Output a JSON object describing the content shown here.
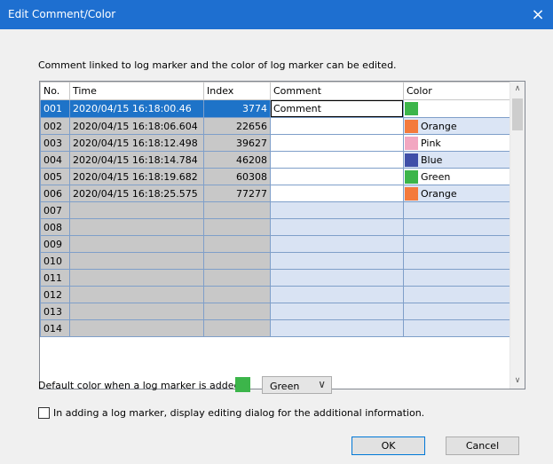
{
  "window": {
    "title": "Edit Comment/Color"
  },
  "instruction": "Comment linked to log marker and the color of log marker can be edited.",
  "grid": {
    "columns": [
      "No.",
      "Time",
      "Index",
      "Comment",
      "Color"
    ],
    "rows": [
      {
        "no": "001",
        "time": "2020/04/15 16:18:00.46",
        "index": "3774",
        "comment": "Comment",
        "color": "Green",
        "swatch": "#3cb54a"
      },
      {
        "no": "002",
        "time": "2020/04/15 16:18:06.604",
        "index": "22656",
        "comment": "",
        "color": "Orange",
        "swatch": "#f47a3c"
      },
      {
        "no": "003",
        "time": "2020/04/15 16:18:12.498",
        "index": "39627",
        "comment": "",
        "color": "Pink",
        "swatch": "#f2a7c1"
      },
      {
        "no": "004",
        "time": "2020/04/15 16:18:14.784",
        "index": "46208",
        "comment": "",
        "color": "Blue",
        "swatch": "#3f4fa8"
      },
      {
        "no": "005",
        "time": "2020/04/15 16:18:19.682",
        "index": "60308",
        "comment": "",
        "color": "Green",
        "swatch": "#3cb54a"
      },
      {
        "no": "006",
        "time": "2020/04/15 16:18:25.575",
        "index": "77277",
        "comment": "",
        "color": "Orange",
        "swatch": "#f47a3c"
      },
      {
        "no": "007"
      },
      {
        "no": "008"
      },
      {
        "no": "009"
      },
      {
        "no": "010"
      },
      {
        "no": "011"
      },
      {
        "no": "012"
      },
      {
        "no": "013"
      },
      {
        "no": "014"
      }
    ]
  },
  "default_color": {
    "label": "Default color when a log marker is added:",
    "value": "Green",
    "swatch": "#3cb54a"
  },
  "checkbox": {
    "label": "In adding a log marker, display editing dialog for the additional information."
  },
  "buttons": {
    "ok": "OK",
    "cancel": "Cancel"
  },
  "icons": {
    "close": "×",
    "scroll_up": "∧",
    "scroll_down": "∨",
    "chevron": "∨"
  }
}
